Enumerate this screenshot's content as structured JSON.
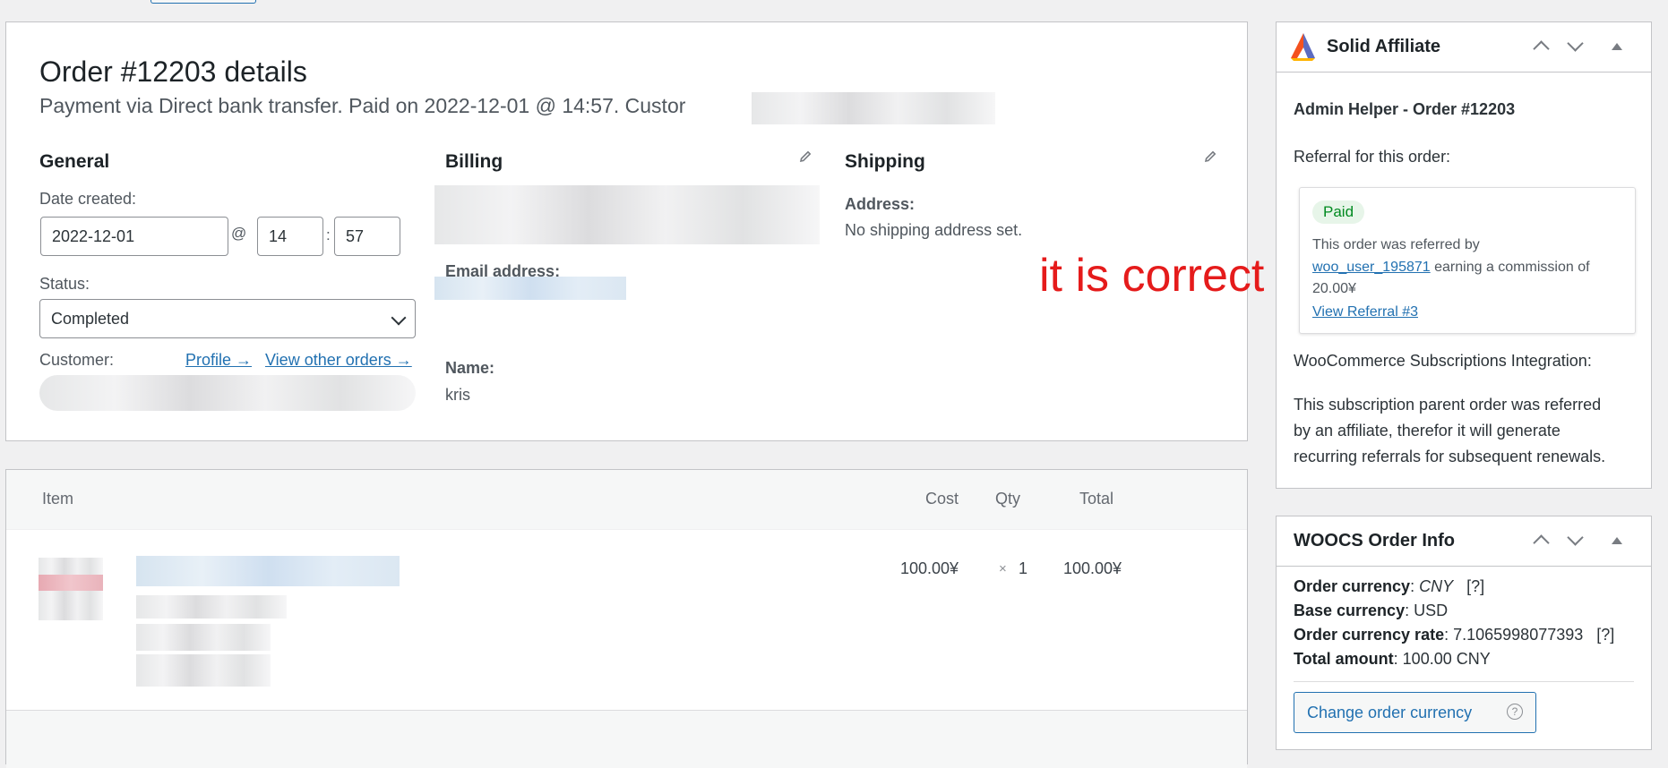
{
  "order": {
    "title": "Order #12203 details",
    "subtitle": "Payment via Direct bank transfer. Paid on 2022-12-01 @ 14:57. Custor",
    "general": {
      "heading": "General",
      "date_created_label": "Date created:",
      "date_value": "2022-12-01",
      "at_symbol": "@",
      "hour_value": "14",
      "time_sep": ":",
      "minute_value": "57",
      "status_label": "Status:",
      "status_value": "Completed",
      "customer_label": "Customer:",
      "profile_link": "Profile →",
      "other_orders_link": "View other orders →"
    },
    "billing": {
      "heading": "Billing",
      "email_label": "Email address:",
      "name_label": "Name:",
      "name_value": "kris"
    },
    "shipping": {
      "heading": "Shipping",
      "address_label": "Address:",
      "address_value": "No shipping address set."
    }
  },
  "items": {
    "columns": [
      "Item",
      "Cost",
      "Qty",
      "Total"
    ],
    "rows": [
      {
        "cost": "100.00¥",
        "qty_prefix": "×",
        "qty": "1",
        "total": "100.00¥"
      }
    ]
  },
  "annotation": {
    "text": "it is correct",
    "color": "#e51b1b"
  },
  "solid_affiliate": {
    "title": "Solid Affiliate",
    "admin_helper": "Admin Helper - Order #12203",
    "referral_label": "Referral for this order:",
    "status_badge": "Paid",
    "referred_by_text": "This order was referred by",
    "affiliate_user": "woo_user_195871",
    "earning_text": " earning a commission of",
    "commission": "20.00¥",
    "view_referral": "View Referral #3",
    "subscriptions_label": "WooCommerce Subscriptions Integration:",
    "subscriptions_text": [
      "This subscription parent order was referred",
      "by an affiliate, therefor it will generate",
      "recurring referrals for subsequent renewals."
    ]
  },
  "woocs": {
    "title": "WOOCS Order Info",
    "order_currency_label": "Order currency",
    "order_currency_value": "CNY",
    "help_marker": "[?]",
    "base_currency_label": "Base currency",
    "base_currency_value": "USD",
    "rate_label": "Order currency rate",
    "rate_value": "7.1065998077393",
    "total_label": "Total amount",
    "total_value": "100.00 CNY",
    "change_button": "Change order currency",
    "help_icon_glyph": "?"
  },
  "colors": {
    "accent": "#2271b1",
    "paid_badge_bg": "#e7f5e9",
    "paid_badge_text": "#008a20",
    "annotation_red": "#e0100e"
  }
}
